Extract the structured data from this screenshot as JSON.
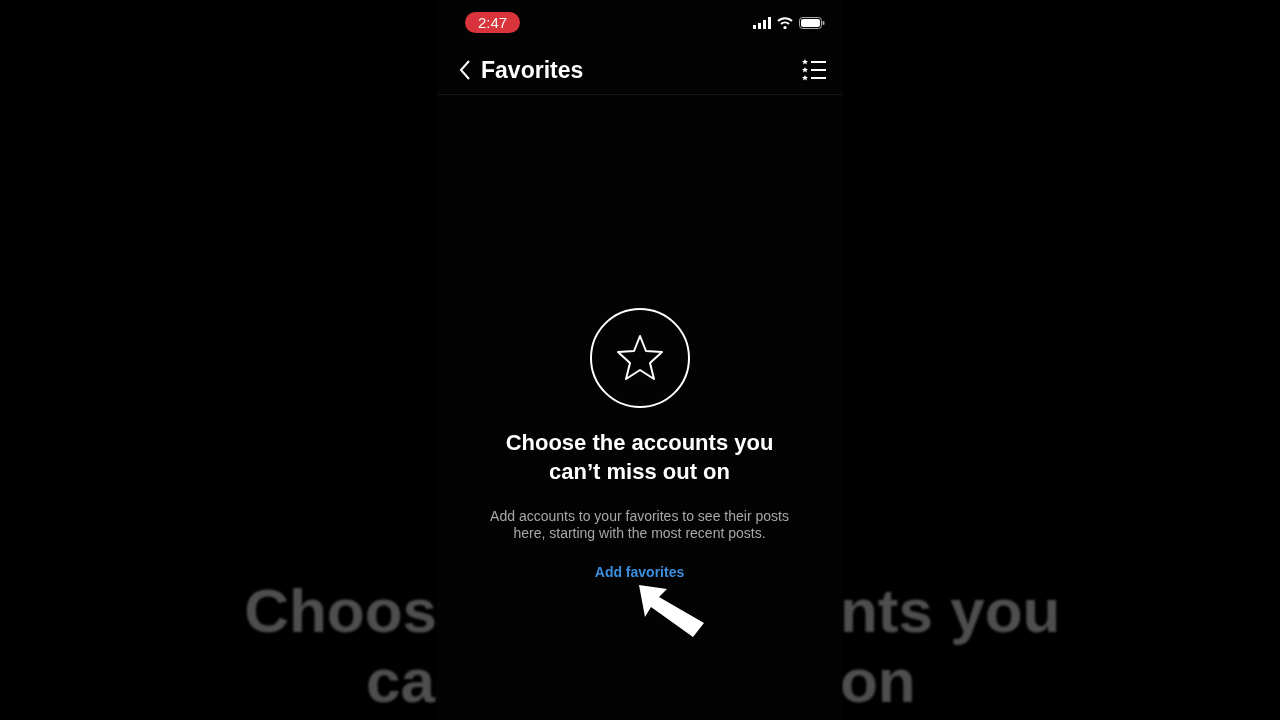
{
  "backdrop": {
    "left_fragments": [
      "Choos",
      "ca"
    ],
    "right_fragments": [
      "nts you",
      "on"
    ]
  },
  "status_bar": {
    "time": "2:47",
    "recording": true
  },
  "nav": {
    "title": "Favorites"
  },
  "empty_state": {
    "title": "Choose the accounts you can’t miss out on",
    "body": "Add accounts to your favorites to see their posts here, starting with the most recent posts.",
    "link": "Add favorites"
  },
  "pointer": {
    "visible": true
  }
}
